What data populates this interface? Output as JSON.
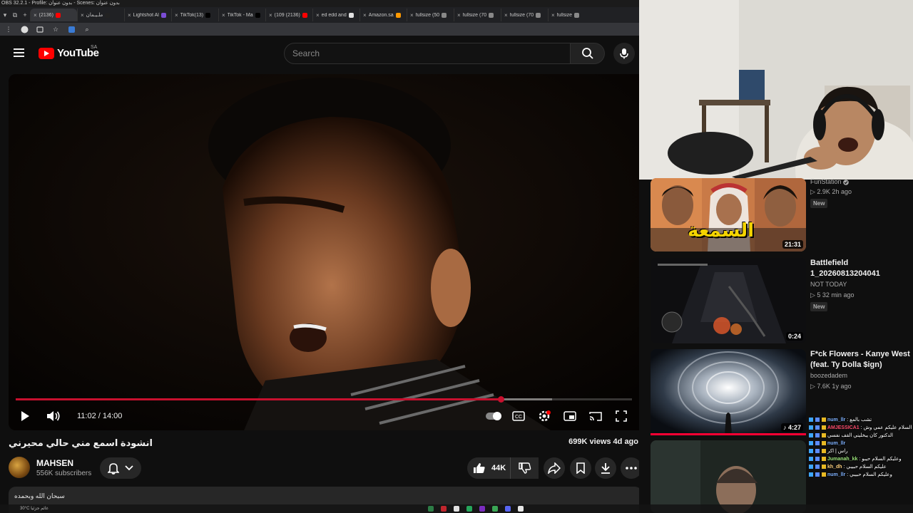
{
  "obs": {
    "title": "OBS 32.2.1 - Profile: بدون عنوان - Scenes: بدون عنوان"
  },
  "browser": {
    "tabs": [
      {
        "label": "(2136)",
        "color": "#ff0000"
      },
      {
        "label": "ملـيـمان",
        "color": "#222222"
      },
      {
        "label": "Lightshot Al",
        "color": "#7b4dd6"
      },
      {
        "label": "TikTok(13)",
        "color": "#000000"
      },
      {
        "label": "TikTok - Ma",
        "color": "#000000"
      },
      {
        "label": "(109 (2136)",
        "color": "#ff0000"
      },
      {
        "label": "ed edd and",
        "color": "#e0e0e0"
      },
      {
        "label": "Amazon.sa",
        "color": "#ff9900"
      },
      {
        "label": "fullsize (50",
        "color": "#888888"
      },
      {
        "label": "fullsize (70",
        "color": "#888888"
      },
      {
        "label": "fullsize (70",
        "color": "#888888"
      },
      {
        "label": "fullsize",
        "color": "#888888"
      }
    ],
    "new_tab_glyph": "+",
    "close_glyph": "×"
  },
  "youtube": {
    "logo_text": "YouTube",
    "country": "SA",
    "search_placeholder": "Search"
  },
  "player": {
    "time": "11:02 / 14:00",
    "progress_fraction": 0.787,
    "buffer_fraction": 0.87
  },
  "video": {
    "title": "انشودة اسمع مني حالي محيرني",
    "views": "699K views  4d ago",
    "channel": "MAHSEN",
    "subscribers": "556K subscribers",
    "likes": "44K",
    "description": "سبحان الله وبحمده"
  },
  "recommendations": [
    {
      "title": "",
      "channel": "FunStation",
      "meta": "▷ 2.9K  2h ago",
      "badge": "New",
      "duration": "21:31",
      "thumb_text": "السمعة"
    },
    {
      "title": "Battlefield 1_20260813204041",
      "channel": "NOT TODAY",
      "meta": "▷ 5  32 min ago",
      "badge": "New",
      "duration": "0:24"
    },
    {
      "title": "F*ck Flowers - Kanye West (feat. Ty Dolla $ign)",
      "channel": "boozedadem",
      "meta": "▷ 7.6K  1y ago",
      "badge": "",
      "duration": "♪ 4:27"
    }
  ],
  "chat": [
    {
      "user": "num_llr",
      "msg": ": تشب بالمع",
      "color": "#7fb2ff"
    },
    {
      "user": "AMJESSICA1",
      "msg": ": السلام عليكم عمي وش",
      "color": "#ff4d6d"
    },
    {
      "user": "",
      "msg": "الدكتور كان يبخليني القف نفسي",
      "color": "#ffffff"
    },
    {
      "user": "num_llr",
      "msg": "",
      "color": "#7fb2ff"
    },
    {
      "user": "",
      "msg": "راس | اكر",
      "color": "#ffffff"
    },
    {
      "user": "Jumanah_kk",
      "msg": ": وعليكم السلام حيبو",
      "color": "#9be37a"
    },
    {
      "user": "kh_dh",
      "msg": ": عليكم السلام حبيبي",
      "color": "#ffd27f"
    },
    {
      "user": "num_llr",
      "msg": ": وعليكم السلام حبيبي",
      "color": "#7fb2ff"
    }
  ],
  "taskbar": {
    "weather": "30°C  غائم جزئيا"
  }
}
